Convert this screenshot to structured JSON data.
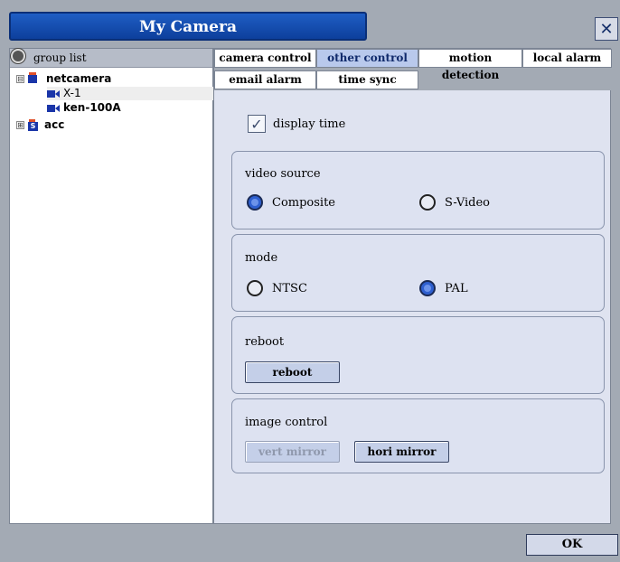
{
  "window": {
    "title": "My Camera",
    "close_icon": "close-icon"
  },
  "tree": {
    "header": "group list",
    "items": [
      {
        "label": "netcamera",
        "kind": "group",
        "expander": "⊟",
        "icon": "camera-group-icon"
      },
      {
        "label": "X-1",
        "kind": "camera",
        "icon": "camera-icon"
      },
      {
        "label": "ken-100A",
        "kind": "camera",
        "icon": "camera-icon"
      },
      {
        "label": "acc",
        "kind": "group",
        "expander": "⊞",
        "icon": "storage-group-icon"
      }
    ]
  },
  "tabs": [
    {
      "label": "camera control",
      "active": false
    },
    {
      "label": "other control",
      "active": true
    },
    {
      "label": "motion detection",
      "active": false
    },
    {
      "label": "local alarm",
      "active": false
    },
    {
      "label": "email alarm",
      "active": false
    },
    {
      "label": "time sync",
      "active": false
    }
  ],
  "settings": {
    "display_time": {
      "label": "display time",
      "checked": true
    },
    "video_source": {
      "title": "video source",
      "options": [
        "Composite",
        "S-Video"
      ],
      "selected": "Composite"
    },
    "mode": {
      "title": "mode",
      "options": [
        "NTSC",
        "PAL"
      ],
      "selected": "PAL"
    },
    "reboot": {
      "title": "reboot",
      "button": "reboot"
    },
    "image_control": {
      "title": "image control",
      "vert_mirror": "vert mirror",
      "hori_mirror": "hori mirror"
    }
  },
  "footer": {
    "ok": "OK"
  },
  "colors": {
    "title_bar": "#1f5ec4",
    "panel": "#dfe3f0",
    "active_tab": "#b9c9ec",
    "radio_on": "#2e5fcf"
  }
}
